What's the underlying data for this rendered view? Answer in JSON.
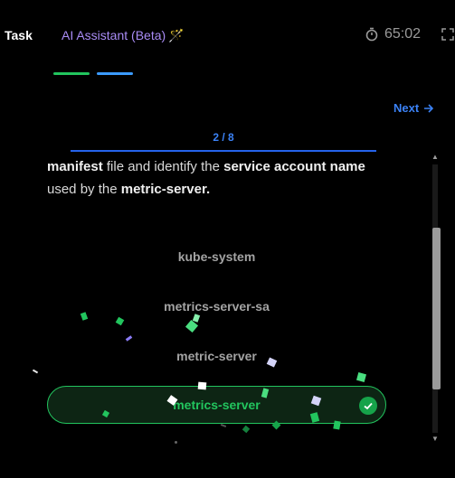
{
  "header": {
    "tab_task": "Task",
    "tab_ai": "AI Assistant (Beta)",
    "timer": "65:02"
  },
  "nav": {
    "next_label": "Next"
  },
  "question": {
    "counter": "2 / 8",
    "text_parts": [
      {
        "t": "manifest",
        "b": true
      },
      {
        "t": " file and identify the ",
        "b": false
      },
      {
        "t": "service account name",
        "b": true
      },
      {
        "t": " used by the ",
        "b": false
      },
      {
        "t": "metric-server.",
        "b": true
      }
    ]
  },
  "options": [
    {
      "label": "kube-system",
      "selected": false
    },
    {
      "label": "metrics-server-sa",
      "selected": false
    },
    {
      "label": "metric-server",
      "selected": false
    },
    {
      "label": "metrics-server",
      "selected": true
    }
  ],
  "colors": {
    "accent_blue": "#3b82f6",
    "success_green": "#22c55e",
    "ai_purple": "#a98cf5"
  }
}
